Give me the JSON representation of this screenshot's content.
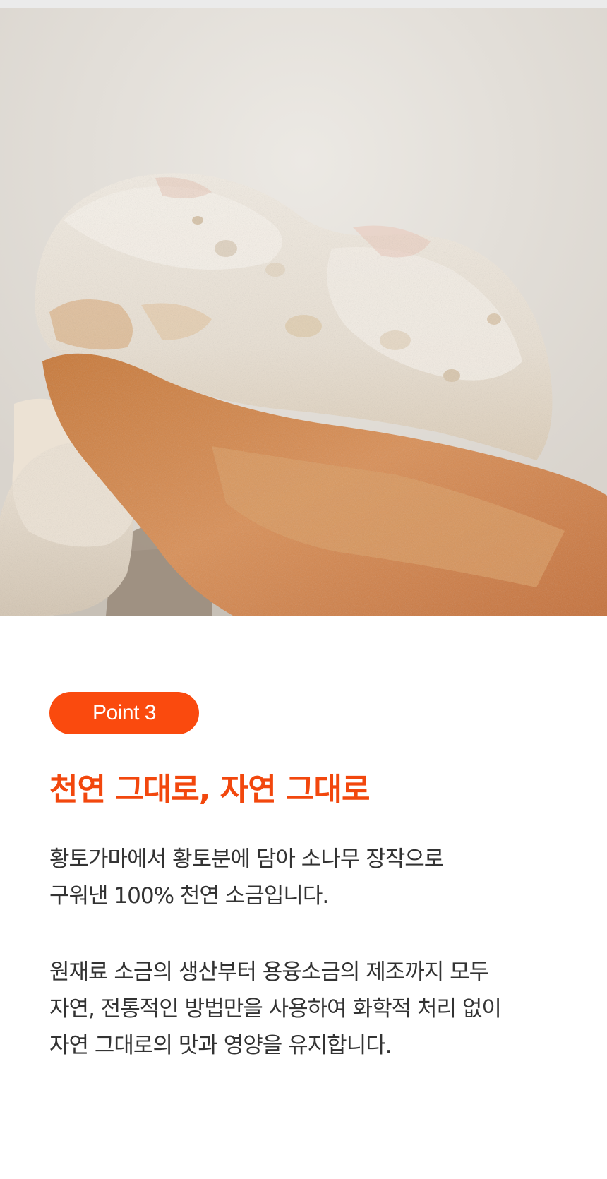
{
  "badge": {
    "label": "Point 3"
  },
  "headline": "천연 그대로, 자연 그대로",
  "paragraphs": [
    {
      "lines": [
        "황토가마에서 황토분에 담아 소나무 장작으로",
        "구워낸 100% 천연 소금입니다."
      ]
    },
    {
      "lines": [
        "원재료 소금의 생산부터 용융소금의 제조까지 모두",
        "자연, 전통적인 방법만을 사용하여 화학적 처리 없이",
        "자연 그대로의 맛과 영양을 유지합니다."
      ]
    }
  ],
  "colors": {
    "accent": "#fa4a0e",
    "headline": "#f2470d",
    "body_text": "#333333"
  },
  "hero_image": {
    "icon": "salt-crystal-photo"
  }
}
